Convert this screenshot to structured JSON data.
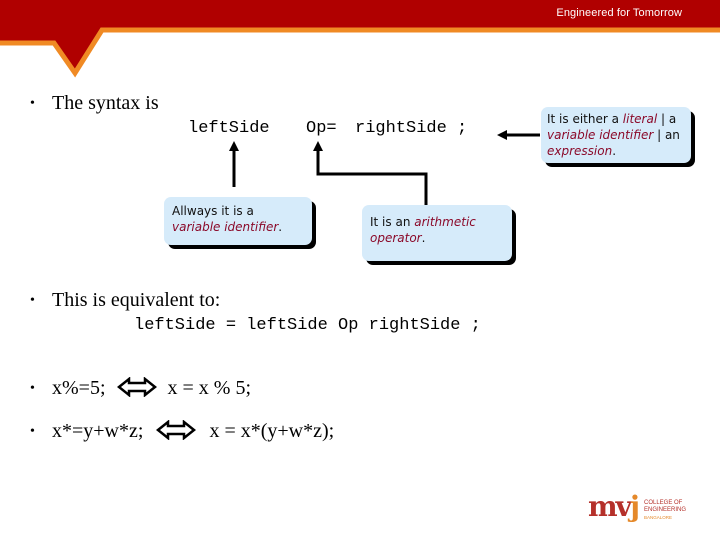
{
  "header": {
    "tagline": "Engineered for Tomorrow",
    "colors": {
      "banner": "#b00000",
      "stripe": "#f08a24"
    }
  },
  "bullets": {
    "syntax": "The syntax is",
    "equivalent": "This is equivalent to:",
    "example1_lhs": "x%=5;",
    "example1_rhs": "x = x % 5;",
    "example2_lhs": "x*=y+w*z;",
    "example2_rhs": "x = x*(y+w*z);",
    "equiv_icon": "double-arrow-icon"
  },
  "syntax_line": {
    "left": "leftSide",
    "op": "Op=",
    "right": "rightSide ;"
  },
  "equivalent_line": "leftSide = leftSide Op rightSide ;",
  "callouts": {
    "left": {
      "text1": "Allways it is a ",
      "em1": "variable identifier",
      "end": "."
    },
    "op": {
      "text1": "It is an ",
      "em1": "arithmetic operator",
      "end": "."
    },
    "right": {
      "text1": "It is either a ",
      "em1": "literal",
      "text2": " | a ",
      "em2": "variable identifier",
      "text3": " | an ",
      "em3": "expression",
      "end": "."
    }
  },
  "logo": {
    "mark_m": "mv",
    "mark_j": "j",
    "line1": "COLLEGE OF",
    "line2": "ENGINEERING",
    "line3": "BANGALORE"
  }
}
